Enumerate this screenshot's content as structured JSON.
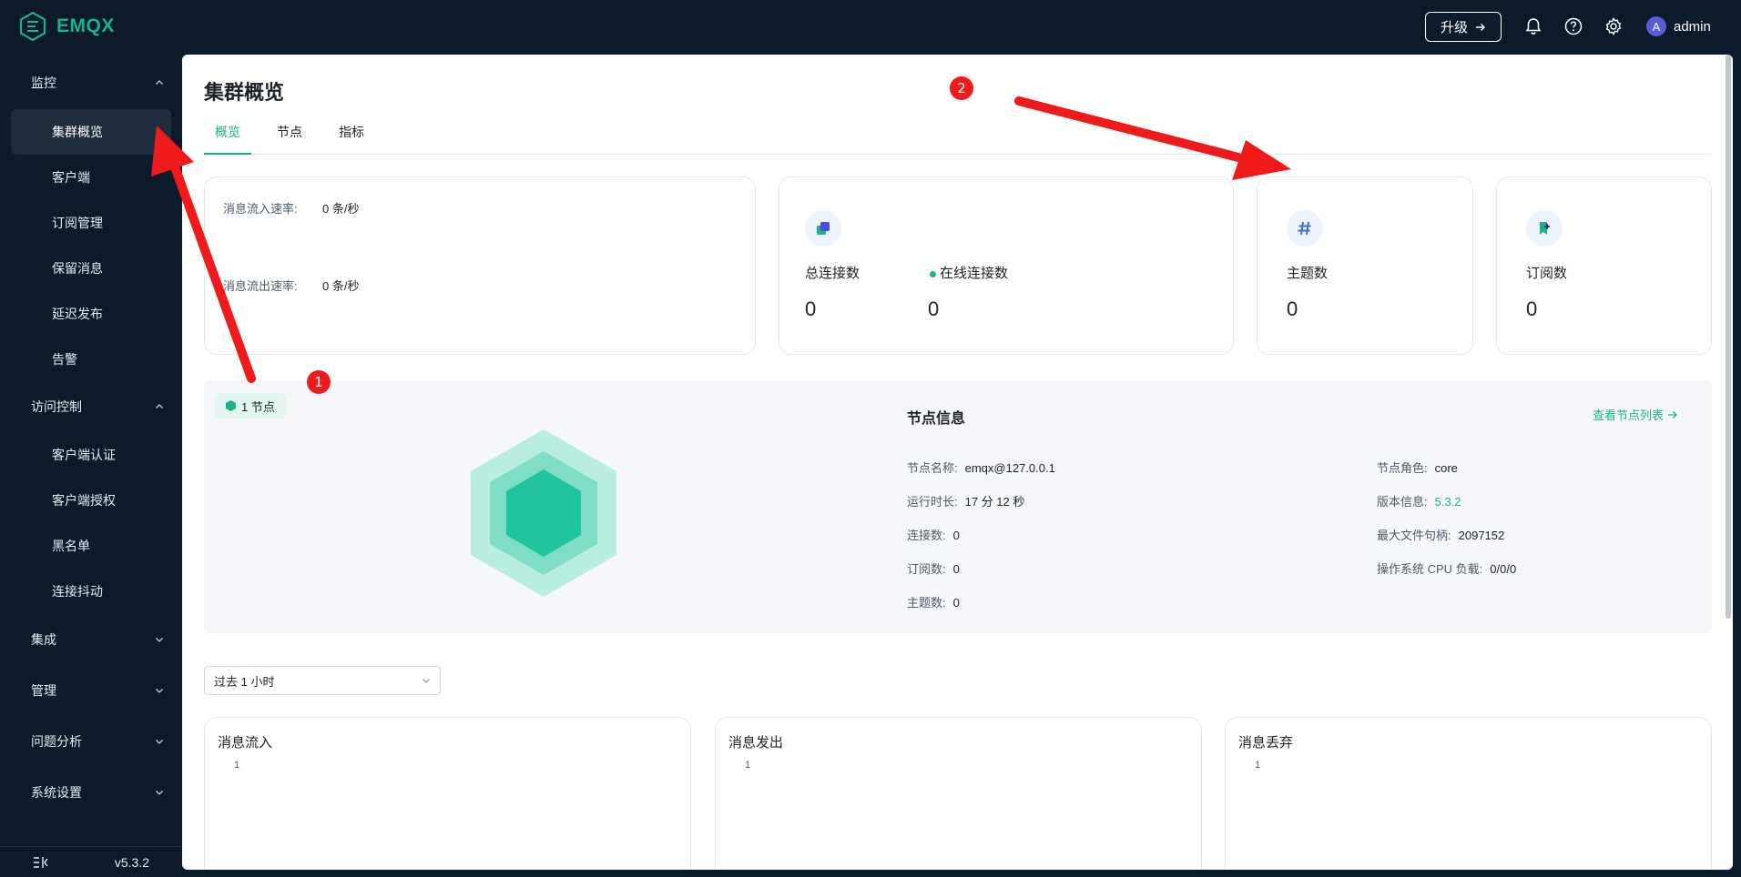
{
  "app": {
    "logo_text": "EMQX",
    "version": "v5.3.2"
  },
  "header": {
    "upgrade_label": "升级",
    "user_initial": "A",
    "username": "admin"
  },
  "sidebar": {
    "groups": [
      {
        "label": "监控",
        "expanded": true,
        "items": [
          "集群概览",
          "客户端",
          "订阅管理",
          "保留消息",
          "延迟发布",
          "告警"
        ]
      },
      {
        "label": "访问控制",
        "expanded": true,
        "items": [
          "客户端认证",
          "客户端授权",
          "黑名单",
          "连接抖动"
        ]
      },
      {
        "label": "集成",
        "expanded": false
      },
      {
        "label": "管理",
        "expanded": false
      },
      {
        "label": "问题分析",
        "expanded": false
      },
      {
        "label": "系统设置",
        "expanded": false
      }
    ],
    "active_item": "集群概览"
  },
  "page": {
    "title": "集群概览",
    "tabs": [
      "概览",
      "节点",
      "指标"
    ],
    "active_tab": "概览"
  },
  "rates": {
    "in_label": "消息流入速率:",
    "in_value": "0 条/秒",
    "out_label": "消息流出速率:",
    "out_value": "0 条/秒"
  },
  "stats": {
    "total_conn_label": "总连接数",
    "total_conn_value": "0",
    "online_conn_label": "在线连接数",
    "online_conn_value": "0",
    "topics_label": "主题数",
    "topics_value": "0",
    "subs_label": "订阅数",
    "subs_value": "0"
  },
  "nodes": {
    "badge": "1 节点",
    "info_title": "节点信息",
    "view_list": "查看节点列表",
    "name_label": "节点名称:",
    "name_value": "emqx@127.0.0.1",
    "uptime_label": "运行时长:",
    "uptime_value": "17 分 12 秒",
    "conn_label": "连接数:",
    "conn_value": "0",
    "subs_label": "订阅数:",
    "subs_value": "0",
    "topics_label": "主题数:",
    "topics_value": "0",
    "role_label": "节点角色:",
    "role_value": "core",
    "version_label": "版本信息:",
    "version_value": "5.3.2",
    "max_fds_label": "最大文件句柄:",
    "max_fds_value": "2097152",
    "cpu_label": "操作系统 CPU 负载:",
    "cpu_value": "0/0/0"
  },
  "time_range": {
    "selected": "过去 1 小时"
  },
  "charts": [
    {
      "title": "消息流入",
      "tick": "1"
    },
    {
      "title": "消息发出",
      "tick": "1"
    },
    {
      "title": "消息丢弃",
      "tick": "1"
    }
  ],
  "annotations": {
    "marker1": "1",
    "marker2": "2"
  },
  "colors": {
    "accent": "#19b28a",
    "sidebar_bg": "#0d1a2b",
    "annotation": "#f01a1a"
  }
}
